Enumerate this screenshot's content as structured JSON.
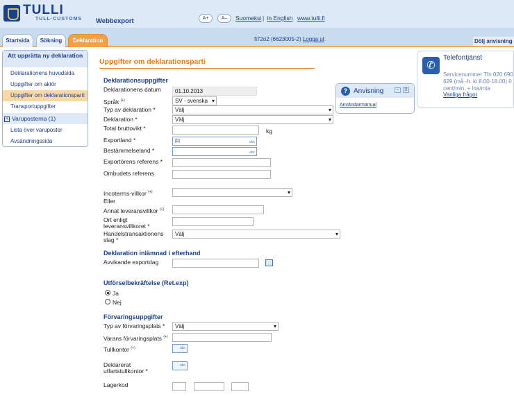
{
  "header": {
    "logo_text": "TULLI",
    "logo_sub": "TULL·CUSTOMS",
    "app_name": "Webbexport",
    "font_plus": "A+",
    "font_minus": "A–",
    "link_suomeksi": "Suomeksi",
    "separator": "|",
    "link_english": "In English",
    "link_tulli": "www.tulli.fi"
  },
  "tabs": {
    "startsida": "Startsida",
    "sokning": "Sökning",
    "deklaration": "Deklaration"
  },
  "user": {
    "id": "fi72o2 (6623005-2)",
    "logout": "Logga ut"
  },
  "hide_help": "Dölj anvisning",
  "sidebar": {
    "heading": "Att upprätta ny deklaration",
    "items": [
      "Deklarationens huvudsida",
      "Uppgifter om aktör",
      "Uppgifter om deklarationsparti",
      "Transportuppgifter",
      "Varuposterna (1)",
      "Lista över varuposter",
      "Avsändningssida"
    ],
    "plus": "+"
  },
  "main": {
    "title": "Uppgifter om deklarationsparti",
    "section_decl": "Deklarationsuppgifter",
    "datum_label": "Deklarationens datum",
    "datum_value": "01.10.2013",
    "sprak_label": "Språk",
    "sprak_value": "SV - svenska",
    "typ_label": "Typ av deklaration *",
    "typ_value": "Välj",
    "deklaration_label": "Deklaration *",
    "deklaration_value": "Välj",
    "brutto_label": "Total bruttovikt *",
    "kg": "kg",
    "exportland_label": "Exportland *",
    "exportland_value": "FI",
    "bestamm_label": "Bestämmelseland *",
    "exportor_label": "Exportörens referens *",
    "ombud_label": "Ombudets referens",
    "incoterms_label": "Incoterms-villkor",
    "eller": "Eller",
    "annat_label": "Annat leveransvillkor",
    "ort_label": "Ort enligt leveransvillkoret *",
    "handel_label": "Handelstransaktionens slag *",
    "handel_value": "Välj",
    "section_efterhand": "Deklaration inlämnad i efterhand",
    "avvik_label": "Avvikande exportdag",
    "section_utforsel": "Utförselbekräftelse (Ret.exp)",
    "radio_ja": "Ja",
    "radio_nej": "Nej",
    "section_forvar": "Förvaringsuppgifter",
    "forvar_typ_label": "Typ av förvaringsplats *",
    "forvar_typ_value": "Välj",
    "varans_label": "Varans förvaringsplats",
    "tullkontor_label": "Tullkontor",
    "deklarerat_label": "Deklarerat utfartstullkontor *",
    "lagerkod_label": "Lagerkod",
    "superscript": "(+)",
    "abc": "abc"
  },
  "help": {
    "title": "Anvisning",
    "link": "Användarmanual",
    "min": "–",
    "close": "X",
    "q": "?"
  },
  "phone": {
    "title": "Telefontjänst",
    "text": "Servicenummer Tfn 020 690 629 (må -fr. kl 8.00-18.00) 0 cent/min. + lna/mta",
    "link": "Vanliga frågor",
    "icon": "phone-icon"
  }
}
